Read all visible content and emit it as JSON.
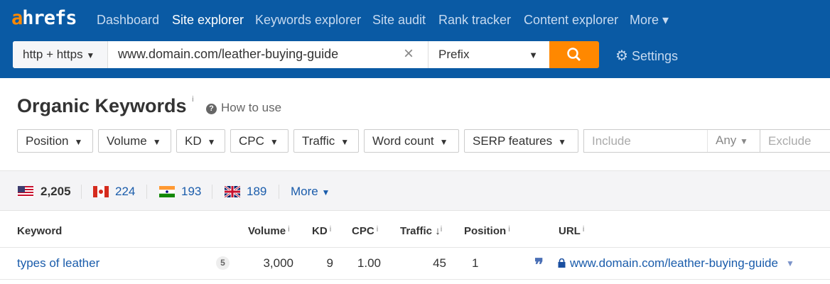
{
  "header": {
    "logo": "ahrefs",
    "nav": [
      {
        "label": "Dashboard"
      },
      {
        "label": "Site explorer",
        "active": true
      },
      {
        "label": "Keywords explorer"
      },
      {
        "label": "Site audit"
      },
      {
        "label": "Rank tracker"
      },
      {
        "label": "Content explorer"
      },
      {
        "label": "More ▾"
      }
    ],
    "search": {
      "protocol": "http + https",
      "url": "www.domain.com/leather-buying-guide",
      "mode": "Prefix"
    },
    "settings": "Settings"
  },
  "page": {
    "title": "Organic Keywords",
    "info": "i",
    "how_to": "How to use"
  },
  "filters": [
    "Position",
    "Volume",
    "KD",
    "CPC",
    "Traffic",
    "Word count",
    "SERP features"
  ],
  "include_placeholder": "Include",
  "any": "Any",
  "exclude_placeholder": "Exclude",
  "countries": [
    {
      "code": "US",
      "count": "2,205"
    },
    {
      "code": "CA",
      "count": "224"
    },
    {
      "code": "IN",
      "count": "193"
    },
    {
      "code": "GB",
      "count": "189"
    }
  ],
  "more": "More",
  "table": {
    "headers": {
      "keyword": "Keyword",
      "volume": "Volume",
      "kd": "KD",
      "cpc": "CPC",
      "traffic": "Traffic",
      "position": "Position",
      "url": "URL"
    },
    "rows": [
      {
        "keyword": "types of leather",
        "serp_count": "5",
        "volume": "3,000",
        "kd": "9",
        "cpc": "1.00",
        "traffic": "45",
        "position": "1",
        "url": "www.domain.com/leather-buying-guide"
      }
    ]
  },
  "colors": {
    "header": "#0a5aa4",
    "accent": "#ff8800",
    "link": "#1a5cab"
  }
}
